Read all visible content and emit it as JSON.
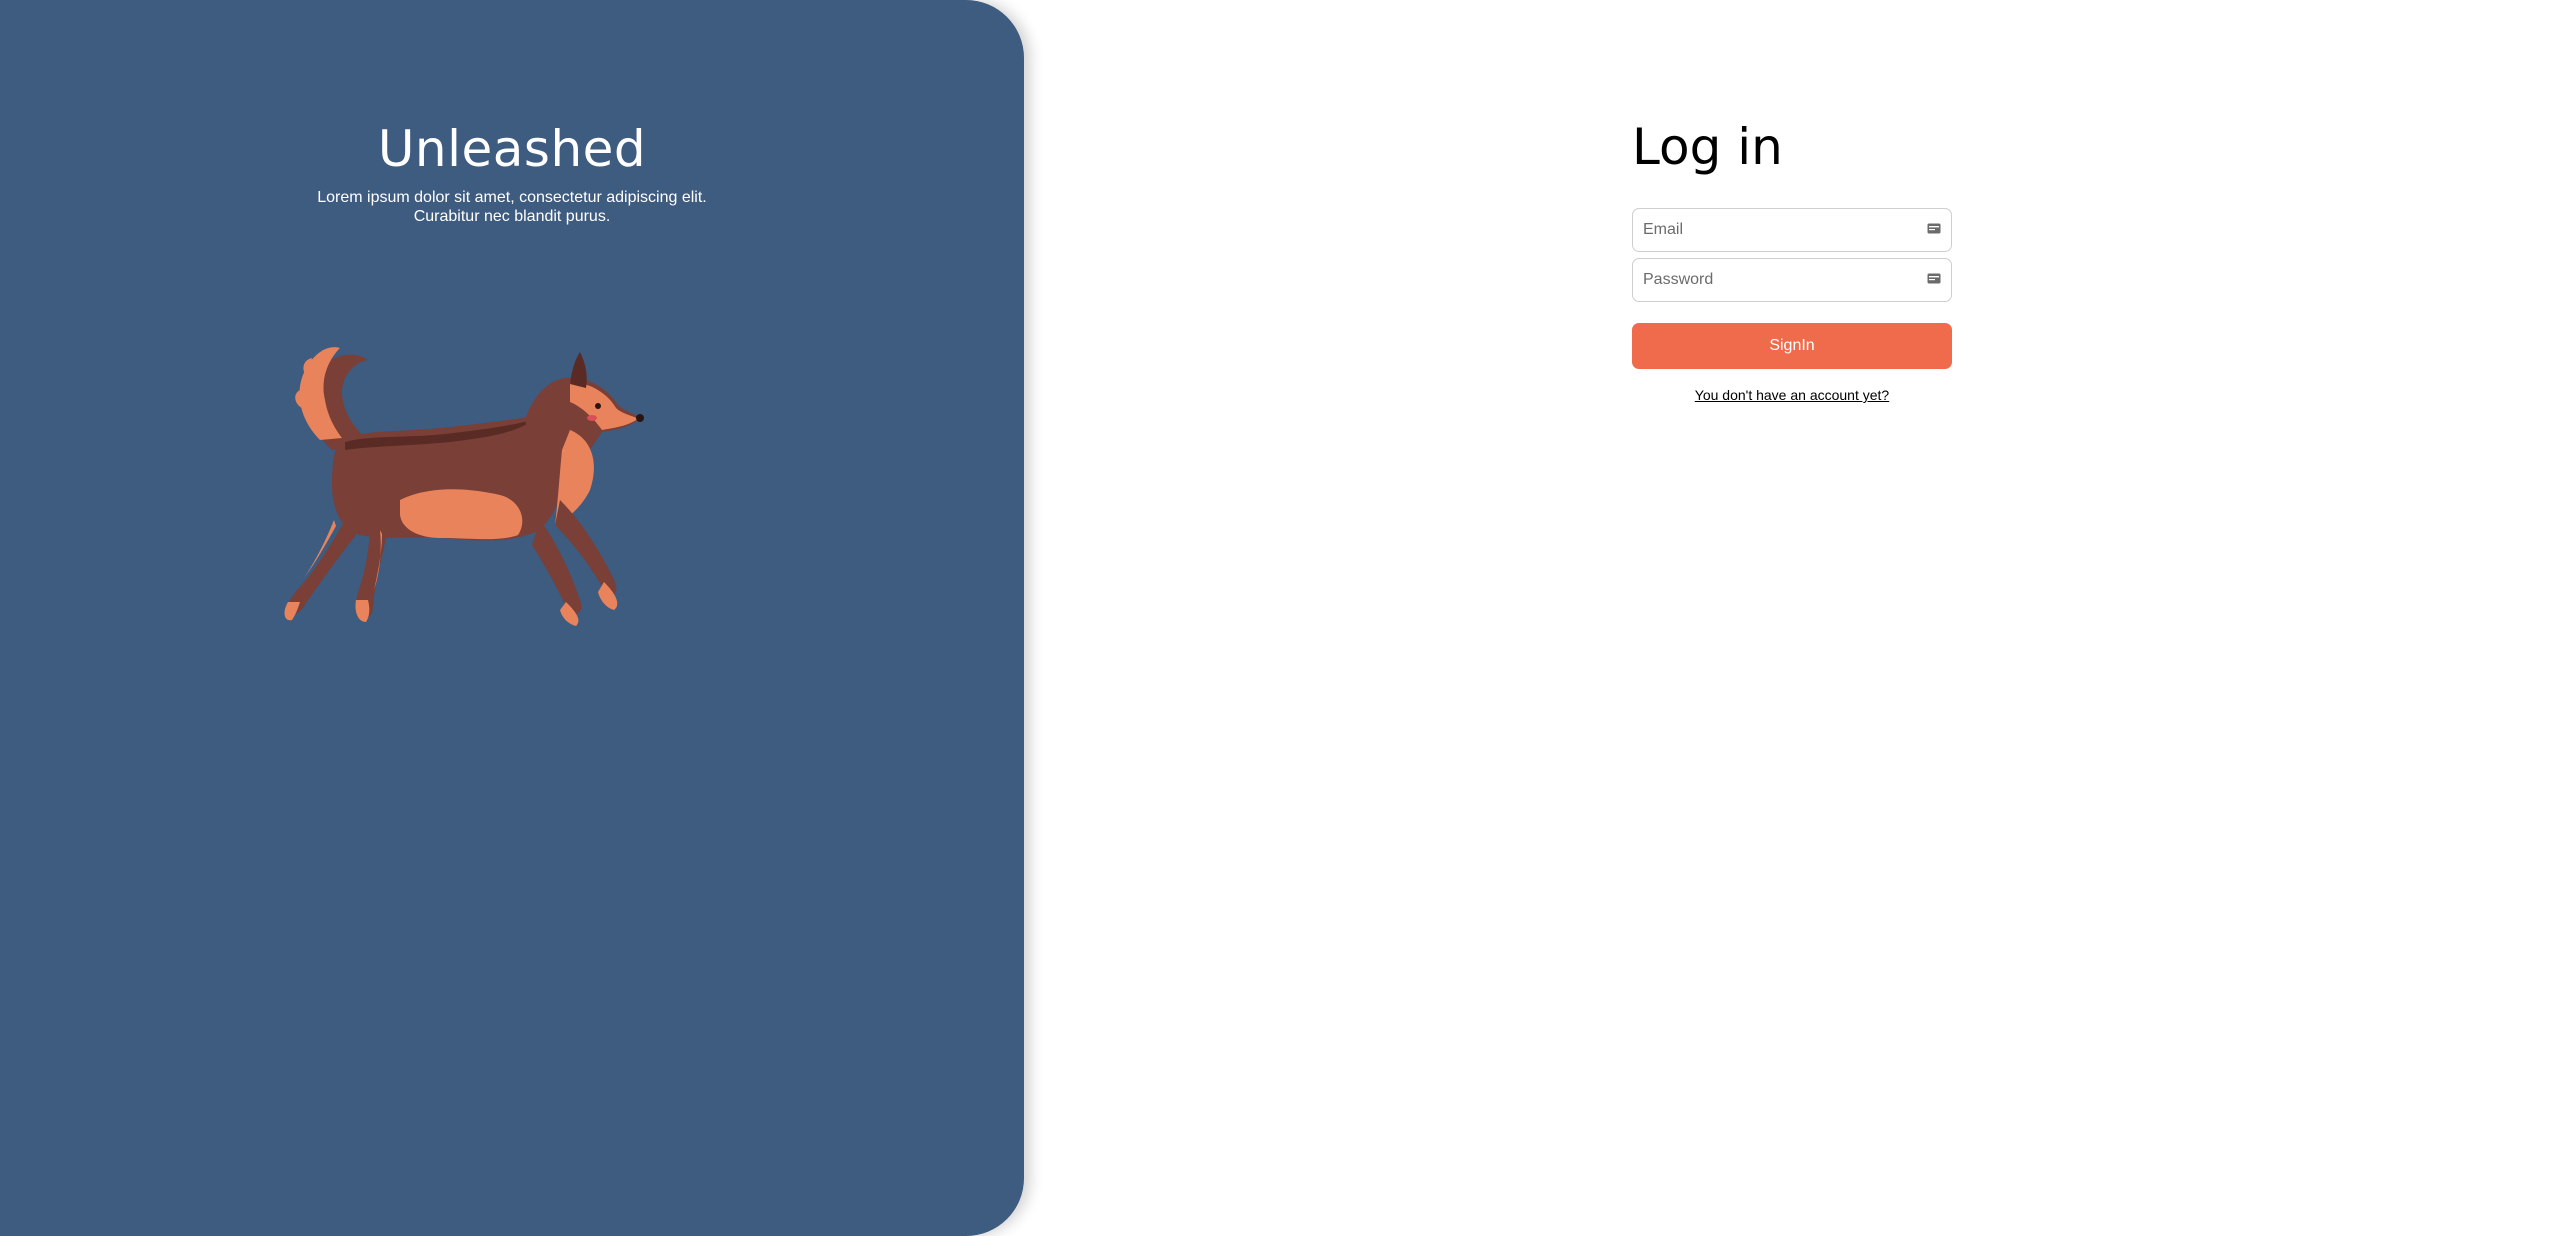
{
  "brand": {
    "title": "Unleashed",
    "tagline_line1": "Lorem ipsum dolor sit amet, consectetur adipiscing elit.",
    "tagline_line2": "Curabitur nec blandit purus.",
    "panel_color": "#3e5b80",
    "illustration": "running-dog-illustration"
  },
  "login": {
    "title": "Log in",
    "email_placeholder": "Email",
    "email_value": "",
    "email_icon": "id-card-icon",
    "password_placeholder": "Password",
    "password_value": "",
    "password_icon": "id-card-icon",
    "signin_label": "SignIn",
    "signin_color": "#ef6b4c",
    "signup_link": "You don't have an account yet?"
  }
}
